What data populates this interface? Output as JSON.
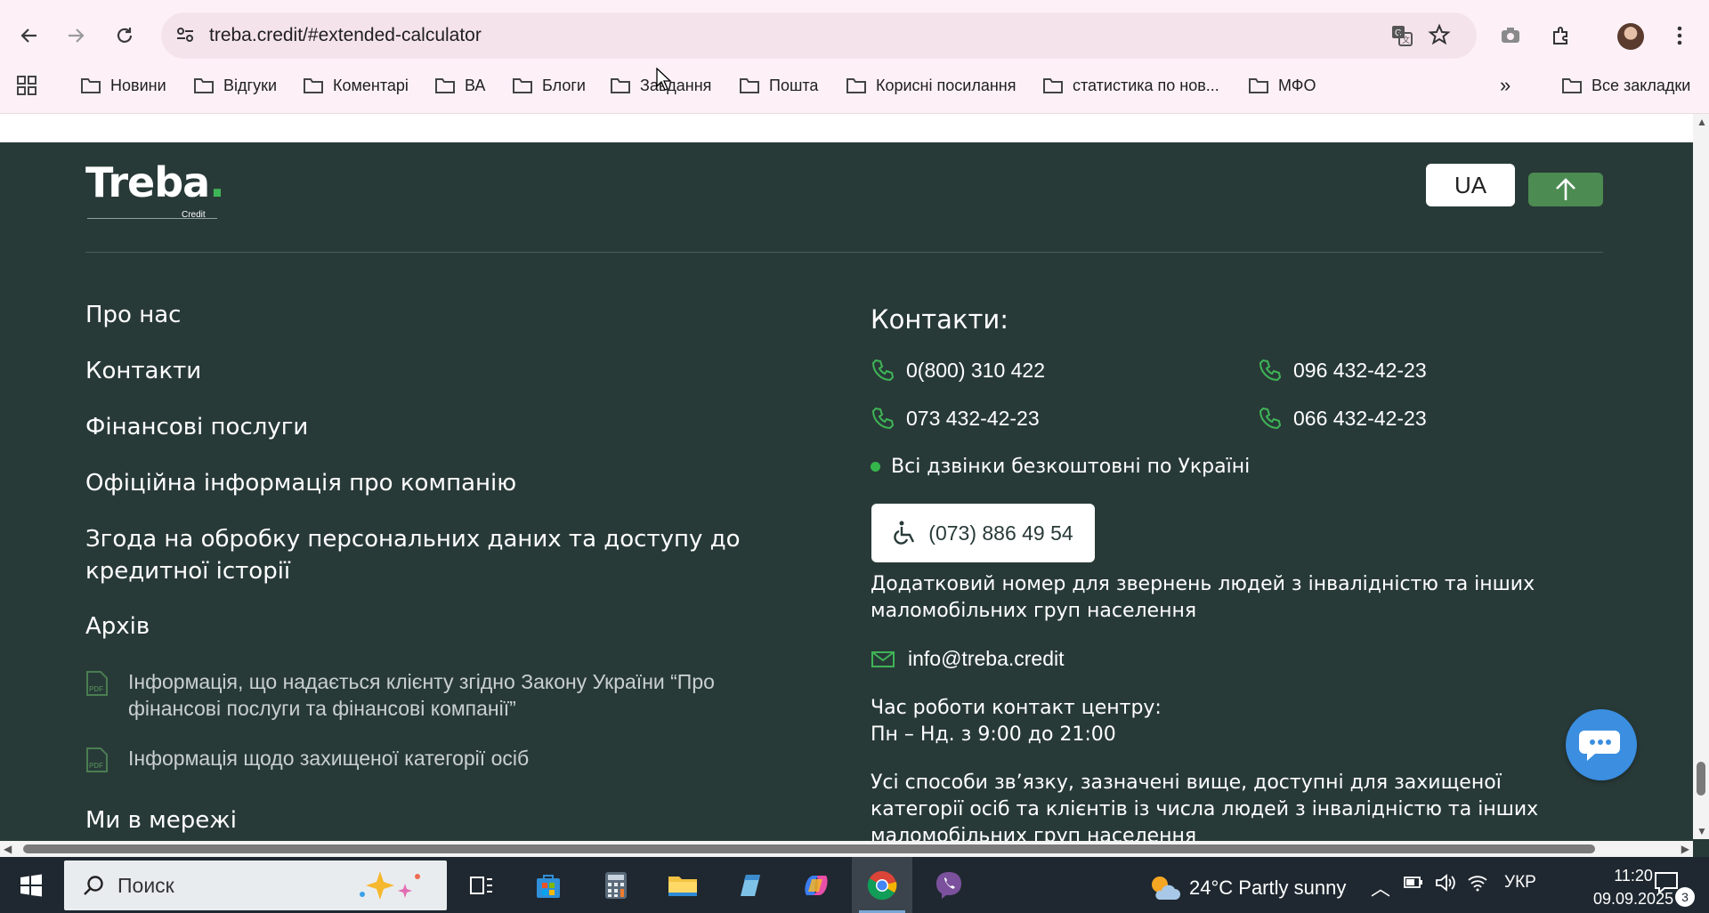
{
  "browser": {
    "url": "treba.credit/#extended-calculator",
    "bookmarks": [
      "Новини",
      "Відгуки",
      "Коментарі",
      "ВА",
      "Блоги",
      "Завдання",
      "Пошта",
      "Корисні посилання",
      "статистика по нов...",
      "МФО"
    ],
    "all_bookmarks": "Все закладки"
  },
  "site": {
    "logo_text": "Treba",
    "logo_sub": "Credit",
    "language": "UA",
    "nav_links": [
      "Про нас",
      "Контакти",
      "Фінансові послуги",
      "Офіційна інформація про компанію",
      "Згода на обробку персональних даних та доступу до кредитної історії",
      "Архів"
    ],
    "pdf_docs": [
      "Інформація, що надається клієнту згідно Закону України “Про фінансові послуги та фінансові компанії”",
      "Інформація щодо захищеної категорії осіб"
    ],
    "social_title": "Ми в мережі",
    "contacts": {
      "title": "Контакти:",
      "phones": [
        "0(800) 310 422",
        "096 432-42-23",
        "073 432-42-23",
        "066 432-42-23"
      ],
      "free_calls": "Всі дзвінки безкоштовні по Україні",
      "accessibility_phone": "(073) 886 49 54",
      "accessibility_note": "Додатковий номер для звернень людей з інвалідністю та інших маломобільних груп населення",
      "email": "info@treba.credit",
      "hours_title": "Час роботи контакт центру:",
      "hours": "Пн – Нд. з 9:00 до 21:00",
      "footer_note": "Усі способи зв’язку, зазначені вище, доступні для захищеної категорії осіб та клієнтів із числа людей з інвалідністю та інших маломобільних груп населення"
    }
  },
  "taskbar": {
    "search_placeholder": "Поиск",
    "weather": "24°C  Partly sunny",
    "language": "УКР",
    "time": "11:20",
    "date": "09.09.2025",
    "notifications": "3"
  },
  "colors": {
    "footer_bg": "#283a38",
    "accent_green": "#3fb456",
    "button_green": "#4c8b52"
  }
}
